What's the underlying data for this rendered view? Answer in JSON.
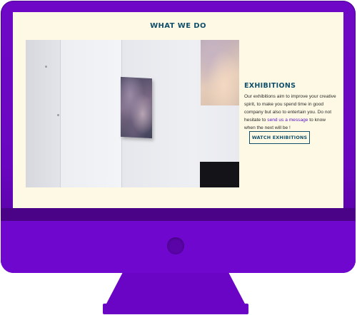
{
  "section": {
    "title": "WHAT WE DO"
  },
  "exhibitions": {
    "title": "EXHIBITIONS",
    "body_before_link": "Our exhibitions aim to improve your creative spirit, to make you spend time in good company but also to entertain you. Do not hesitate to ",
    "link_text": "send us a message",
    "body_after_link": " to know when the next will be !",
    "button_label": "WATCH EXHIBITIONS"
  },
  "colors": {
    "monitor": "#6a06c0",
    "screen_background": "#fdf9e4",
    "heading": "#0f4f6b",
    "link": "#5a12c9"
  }
}
